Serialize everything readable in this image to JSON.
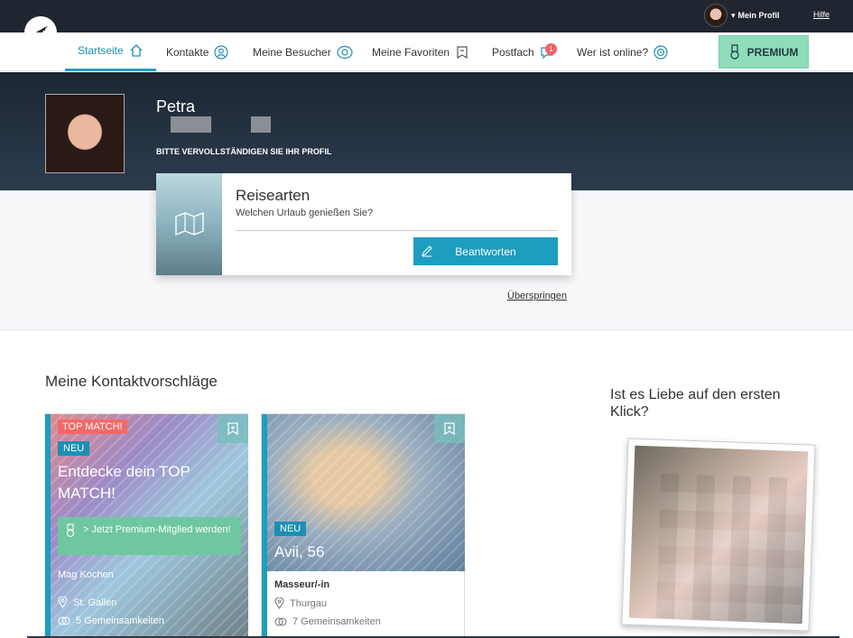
{
  "topbar": {
    "profile_label": "Mein Profil",
    "help_label": "Hilfe"
  },
  "nav": {
    "items": [
      {
        "label": "Startseite",
        "icon": "home-icon"
      },
      {
        "label": "Kontakte",
        "icon": "user-icon"
      },
      {
        "label": "Meine Besucher",
        "icon": "eye-icon"
      },
      {
        "label": "Meine Favoriten",
        "icon": "bookmark-icon"
      },
      {
        "label": "Postfach",
        "icon": "chat-icon",
        "badge": "1"
      },
      {
        "label": "Wer ist online?",
        "icon": "online-icon"
      }
    ],
    "premium_label": "PREMIUM"
  },
  "hero": {
    "name": "Petra",
    "hint": "BITTE VERVOLLSTÄNDIGEN SIE IHR PROFIL"
  },
  "question": {
    "title": "Reisearten",
    "subtitle": "Welchen Urlaub genießen Sie?",
    "answer_label": "Beantworten",
    "skip_label": "Überspringen"
  },
  "suggestions": {
    "title": "Meine Kontaktvorschläge",
    "cards": [
      {
        "top_tag": "TOP MATCH!",
        "new_tag": "NEU",
        "headline": "Entdecke dein TOP MATCH!",
        "cta": "> Jetzt Premium-Mitglied werden!",
        "occupation": "Mag Kochen",
        "location": "St. Gallen",
        "common": "5 Gemeinsamkeiten"
      },
      {
        "new_tag": "NEU",
        "name_age": "Avii, 56",
        "occupation": "Masseur/-in",
        "location": "Thurgau",
        "common": "7 Gemeinsamkeiten"
      }
    ]
  },
  "side": {
    "title": "Ist es Liebe auf den ersten Klick?"
  },
  "colors": {
    "accent": "#1d9dc0",
    "premium": "#8fdcbb",
    "hero": "#1c2632",
    "badge": "#f26161"
  }
}
